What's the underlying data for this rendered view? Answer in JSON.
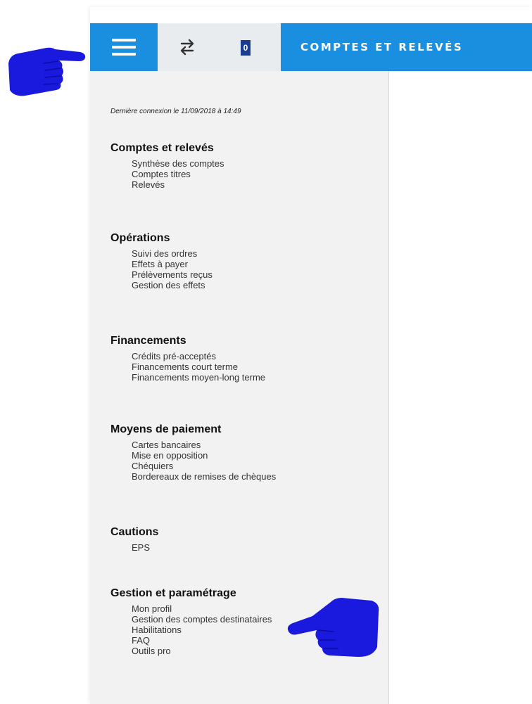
{
  "header": {
    "badge_count": "0",
    "title": "COMPTES ET RELEVÉS",
    "colors": {
      "primary": "#1a8fe0",
      "badge": "#1a3d8f",
      "tool_area": "#e9ecef"
    }
  },
  "sidebar": {
    "last_login": "Dernière connexion le 11/09/2018 à 14:49",
    "sections": [
      {
        "title": "Comptes et relevés",
        "items": [
          "Synthèse des comptes",
          "Comptes titres",
          "Relevés"
        ]
      },
      {
        "title": "Opérations",
        "items": [
          "Suivi des ordres",
          "Effets à payer",
          "Prélèvements reçus",
          "Gestion des effets"
        ]
      },
      {
        "title": "Financements",
        "items": [
          "Crédits pré-acceptés",
          "Financements court terme",
          "Financements moyen-long terme"
        ]
      },
      {
        "title": "Moyens de paiement",
        "items": [
          "Cartes bancaires",
          "Mise en opposition",
          "Chéquiers",
          "Bordereaux de remises de chèques"
        ]
      },
      {
        "title": "Cautions",
        "items": [
          "EPS"
        ]
      },
      {
        "title": "Gestion et paramétrage",
        "items": [
          "Mon profil",
          "Gestion des comptes destinataires",
          "Habilitations",
          "FAQ",
          "Outils pro"
        ]
      }
    ]
  },
  "annotations": {
    "hand_color": "#1a1adf"
  }
}
